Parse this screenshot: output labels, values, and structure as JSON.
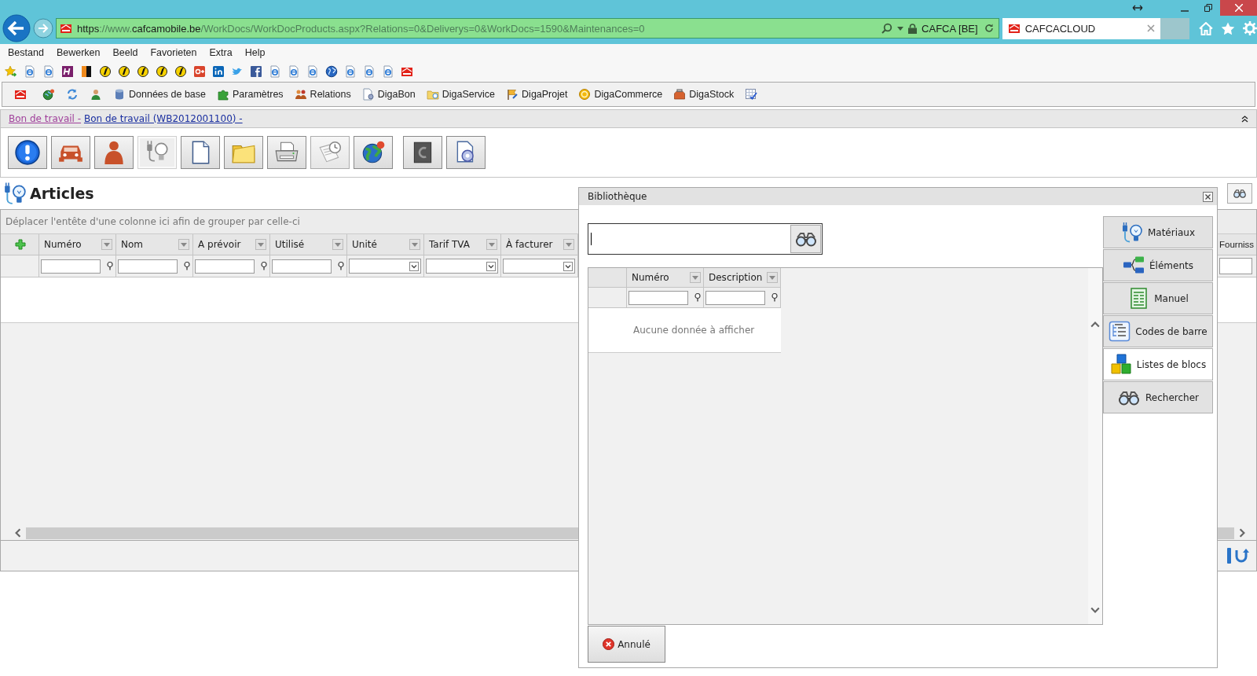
{
  "browser": {
    "address_bar": {
      "url": [
        {
          "text": "https",
          "emphasis": true
        },
        {
          "text": "://www.",
          "emphasis": false
        },
        {
          "text": "cafcamobile.be",
          "emphasis": true
        },
        {
          "text": "/WorkDocs/WorkDocProducts.aspx?Relations=0&Deliverys=0&WorkDocs=1590&Maintenances=0",
          "emphasis": false
        }
      ],
      "site_identity": "CAFCA [BE]"
    },
    "tabs": [
      {
        "title": "CAFCACLOUD",
        "selected": true
      }
    ],
    "menu": [
      {
        "label": "Bestand"
      },
      {
        "label": "Bewerken"
      },
      {
        "label": "Beeld"
      },
      {
        "label": "Favorieten"
      },
      {
        "label": "Extra"
      },
      {
        "label": "Help"
      }
    ],
    "links": [
      {
        "label": "Données de base"
      },
      {
        "label": "Paramètres"
      },
      {
        "label": "Relations"
      },
      {
        "label": "DigaBon"
      },
      {
        "label": "DigaService"
      },
      {
        "label": "DigaProjet"
      },
      {
        "label": "DigaCommerce"
      },
      {
        "label": "DigaStock"
      }
    ]
  },
  "page": {
    "breadcrumb": [
      {
        "text": "Bon de travail -",
        "visited": true
      },
      {
        "text": "Bon de travail (WB2012001100) -",
        "visited": false
      }
    ],
    "action_buttons": [
      {
        "selected": false,
        "disabled": false
      },
      {
        "selected": false,
        "disabled": false
      },
      {
        "selected": false,
        "disabled": false
      },
      {
        "selected": true,
        "disabled": false
      },
      {
        "selected": false,
        "disabled": false
      },
      {
        "selected": false,
        "disabled": false
      },
      {
        "selected": false,
        "disabled": false
      },
      {
        "selected": false,
        "disabled": true
      },
      {
        "selected": false,
        "disabled": false
      },
      {
        "selected": false,
        "disabled": false
      },
      {
        "selected": false,
        "disabled": false
      }
    ],
    "title": "Articles",
    "grid": {
      "group_panel": "Déplacer l'entête d'une colonne ici afin de grouper par celle-ci",
      "columns": [
        {
          "label": "Numéro",
          "kind": "text"
        },
        {
          "label": "Nom",
          "kind": "text"
        },
        {
          "label": "A prévoir",
          "kind": "text"
        },
        {
          "label": "Utilisé",
          "kind": "text"
        },
        {
          "label": "Unité",
          "kind": "select"
        },
        {
          "label": "Tarif TVA",
          "kind": "select"
        },
        {
          "label": "À facturer",
          "kind": "select"
        }
      ],
      "edge_column": "Fourniss"
    }
  },
  "dialog": {
    "title": "Bibliothèque",
    "grid": {
      "columns": [
        {
          "label": "Numéro"
        },
        {
          "label": "Description"
        }
      ],
      "empty_message": "Aucune donnée à afficher"
    },
    "categories": [
      {
        "label": "Matériaux",
        "selected": false
      },
      {
        "label": "Éléments",
        "selected": false
      },
      {
        "label": "Manuel",
        "selected": false
      },
      {
        "label": "Codes de barre",
        "selected": false
      },
      {
        "label": "Listes de blocs",
        "selected": true
      },
      {
        "label": "Rechercher",
        "selected": false
      }
    ],
    "cancel_button": "Annulé"
  }
}
